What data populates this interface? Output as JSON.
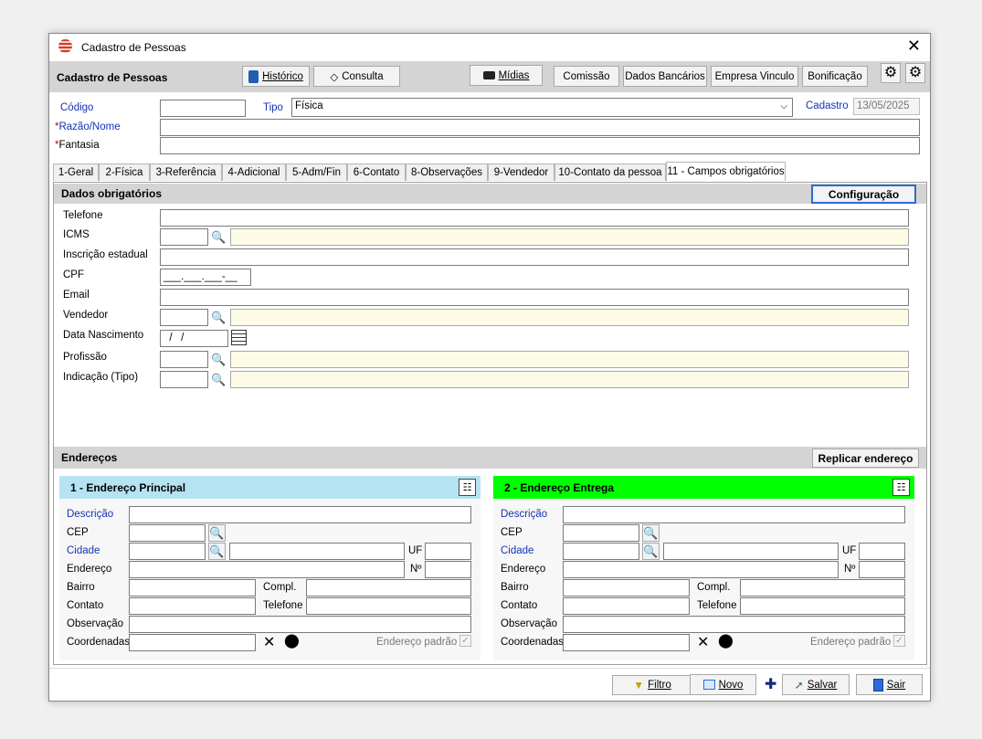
{
  "window": {
    "title": "Cadastro de Pessoas",
    "close": "✕"
  },
  "toolbar": {
    "form_title": "Cadastro de Pessoas",
    "historico": "Histórico",
    "consulta": "Consulta",
    "midias": "Mídias",
    "comissao": "Comissão",
    "dados_bancarios": "Dados Bancários",
    "empresa_vinculo": "Empresa Vinculo",
    "bonificacao": "Bonificação"
  },
  "header_fields": {
    "codigo_label": "Código",
    "codigo_value": "",
    "tipo_label": "Tipo",
    "tipo_value": "Física",
    "cadastro_label": "Cadastro",
    "cadastro_value": "13/05/2025",
    "razao_label": "Razão/Nome",
    "fantasia_label": "Fantasia",
    "required_mark": "*"
  },
  "tabs": [
    {
      "label": "1-Geral"
    },
    {
      "label": "2-Física"
    },
    {
      "label": "3-Referência"
    },
    {
      "label": "4-Adicional"
    },
    {
      "label": "5-Adm/Fin"
    },
    {
      "label": "6-Contato"
    },
    {
      "label": "8-Observações"
    },
    {
      "label": "9-Vendedor"
    },
    {
      "label": "10-Contato da pessoa"
    },
    {
      "label": "11 - Campos obrigatórios"
    }
  ],
  "dados": {
    "header": "Dados obrigatórios",
    "configuracao": "Configuração",
    "telefone": "Telefone",
    "icms": "ICMS",
    "inscricao": "Inscrição estadual",
    "cpf": "CPF",
    "cpf_mask": "___.___.___-__",
    "email": "Email",
    "vendedor": "Vendedor",
    "data_nascimento": "Data Nascimento",
    "data_mask": "  /   /",
    "profissao": "Profissão",
    "indicacao": "Indicação (Tipo)"
  },
  "enderecos": {
    "header": "Endereços",
    "replicar": "Replicar endereço",
    "labels": {
      "descricao": "Descrição",
      "cep": "CEP",
      "cidade": "Cidade",
      "uf": "UF",
      "endereco": "Endereço",
      "numero": "Nº",
      "bairro": "Bairro",
      "compl": "Compl.",
      "contato": "Contato",
      "telefone": "Telefone",
      "observacao": "Observação",
      "coordenadas": "Coordenadas",
      "endereco_padrao": "Endereço padrão"
    },
    "box1_title": "1 - Endereço Principal",
    "box2_title": "2 - Endereço Entrega",
    "box1_color": "#b5e3f2",
    "box2_color": "#00ff00"
  },
  "footer": {
    "filtro": "Filtro",
    "novo": "Novo",
    "salvar": "Salvar",
    "sair": "Sair"
  }
}
